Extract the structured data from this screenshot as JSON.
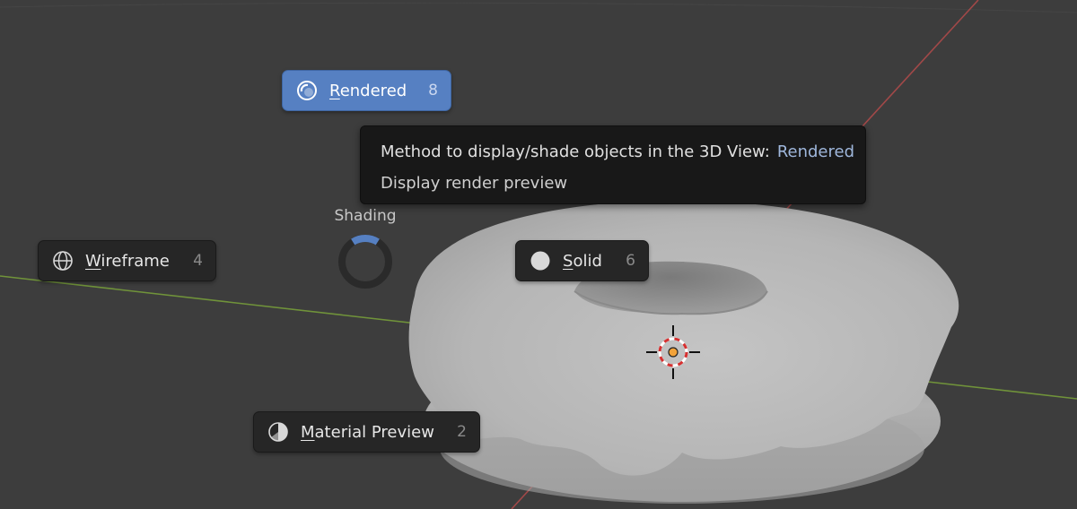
{
  "pie_menu": {
    "title": "Shading",
    "items": [
      {
        "id": "rendered",
        "prefix": "",
        "accel": "R",
        "rest": "endered",
        "key": "8",
        "active": true
      },
      {
        "id": "wireframe",
        "prefix": "",
        "accel": "W",
        "rest": "ireframe",
        "key": "4",
        "active": false
      },
      {
        "id": "solid",
        "prefix": "",
        "accel": "S",
        "rest": "olid",
        "key": "6",
        "active": false
      },
      {
        "id": "material",
        "prefix": "",
        "accel": "M",
        "rest": "aterial Preview",
        "key": "2",
        "active": false
      }
    ],
    "icons": {
      "rendered": "rendered-shading-icon",
      "wireframe": "wireframe-globe-icon",
      "solid": "solid-circle-icon",
      "material": "material-preview-icon"
    }
  },
  "tooltip": {
    "description": "Method to display/shade objects in the 3D View:",
    "value": "Rendered",
    "detail": "Display render preview"
  },
  "colors": {
    "viewport_bg": "#3d3d3d",
    "menu_item_bg": "#262626",
    "menu_item_active": "#5680c2",
    "tooltip_bg": "#181818",
    "tooltip_value": "#9fb7dc",
    "axis_x": "#b34b4b",
    "axis_y": "#7aa33a"
  }
}
